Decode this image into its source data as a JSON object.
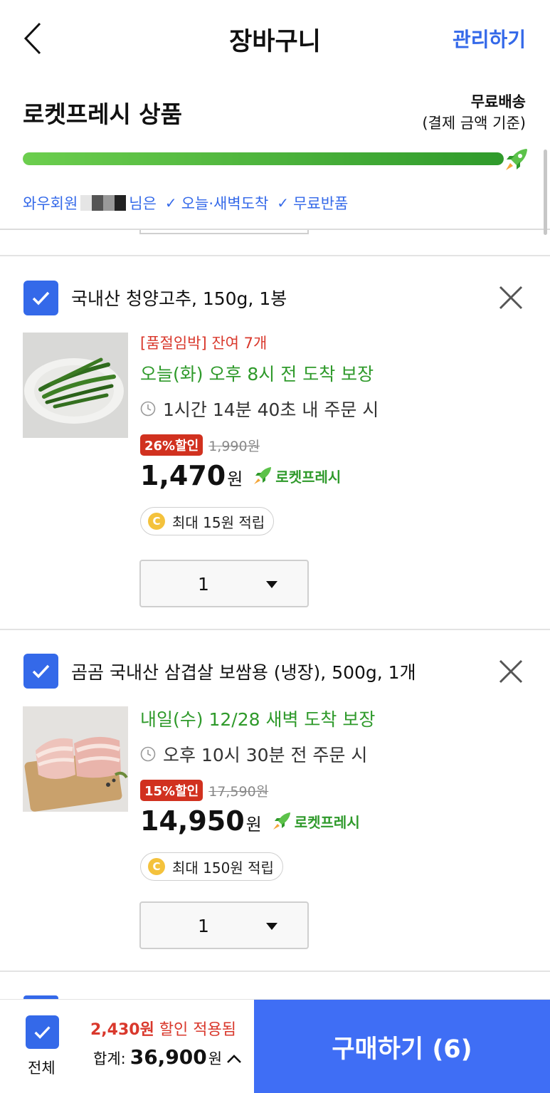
{
  "header": {
    "title": "장바구니",
    "manage_label": "관리하기"
  },
  "fresh": {
    "section_title": "로켓프레시 상품",
    "free_shipping_label": "무료배송",
    "free_shipping_note": "(결제 금액 기준)",
    "progress_fraction": 1.0,
    "member_prefix": "와우회원",
    "member_suffix": "님은",
    "benefit1": "오늘·새벽도착",
    "benefit2": "무료반품",
    "accent_color": "#3469e9",
    "progress_color": "#2f9a2b"
  },
  "items": [
    {
      "name": "국내산 청양고추, 150g, 1봉",
      "stock_notice": "[품절임박] 잔여 7개",
      "arrival": "오늘(화) 오후 8시 전 도착 보장",
      "deadline": "1시간 14분 40초 내 주문 시",
      "discount_badge": "26%할인",
      "original_price": "1,990원",
      "price": "1,470",
      "price_unit": "원",
      "delivery_tag": "로켓프레시",
      "reward": "최대 15원 적립",
      "reward_coin": "C",
      "quantity": "1"
    },
    {
      "name": "곰곰 국내산 삼겹살 보쌈용 (냉장), 500g, 1개",
      "arrival": "내일(수) 12/28 새벽 도착 보장",
      "deadline": "오후 10시 30분 전 주문 시",
      "discount_badge": "15%할인",
      "original_price": "17,590원",
      "price": "14,950",
      "price_unit": "원",
      "delivery_tag": "로켓프레시",
      "reward": "최대 150원 적립",
      "reward_coin": "C",
      "quantity": "1"
    }
  ],
  "bottom": {
    "select_all_label": "전체",
    "discount_amount": "2,430원",
    "discount_text": " 할인 적용됨",
    "total_label": "합계:",
    "total_value": "36,900",
    "total_unit": "원",
    "buy_label": "구매하기 (6)",
    "buy_color": "#3f6ef5"
  }
}
